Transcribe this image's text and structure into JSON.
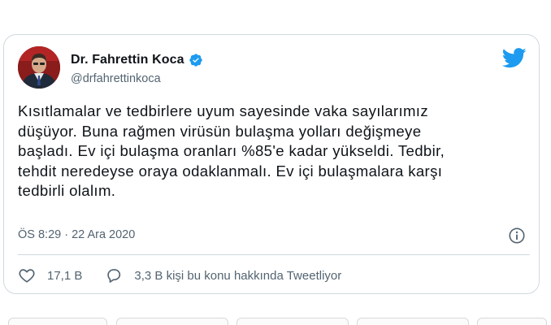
{
  "tweet": {
    "display_name": "Dr. Fahrettin Koca",
    "handle": "@drfahrettinkoca",
    "text": "Kısıtlamalar ve tedbirlere uyum sayesinde vaka sayılarımız\ndüşüyor. Buna rağmen virüsün bulaşma yolları değişmeye\nbaşladı. Ev içi bulaşma oranları %85'e kadar yükseldi. Tedbir,\ntehdit neredeyse oraya odaklanmalı. Ev içi bulaşmalara karşı\ntedbirli olalım.",
    "timestamp": "ÖS 8:29 · 22 Ara 2020",
    "likes": "17,1 B",
    "replies": "3,3 B kişi bu konu hakkında Tweetliyor"
  },
  "icons": {
    "avatar": "avatar",
    "verified": "verified-badge-icon",
    "brand": "twitter-bird-icon",
    "info": "info-icon",
    "like": "heart-icon",
    "reply": "speech-bubble-icon"
  },
  "colors": {
    "brand": "#1d9bf0",
    "text": "#0f1419",
    "muted": "#536471",
    "border": "#cfd9de"
  }
}
